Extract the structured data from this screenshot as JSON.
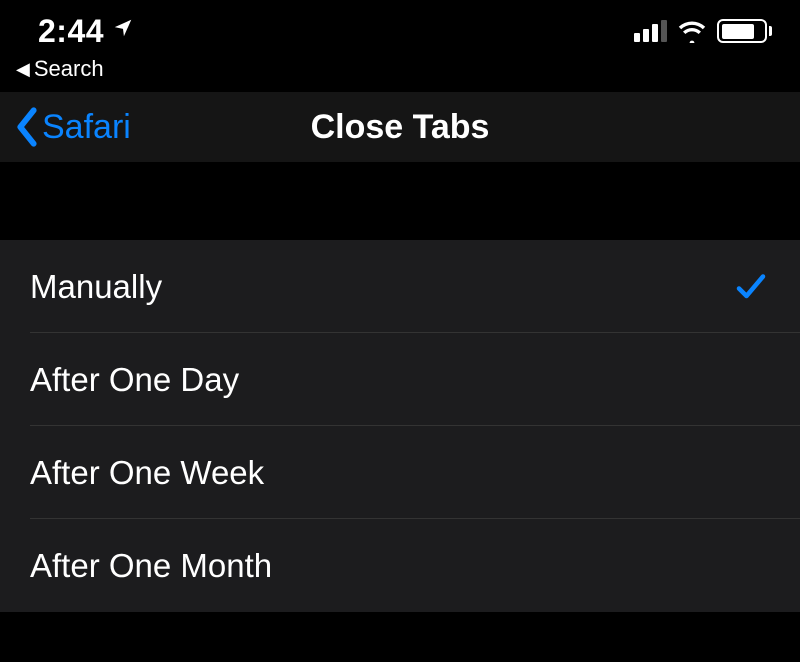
{
  "status": {
    "time": "2:44",
    "breadcrumb": "Search"
  },
  "nav": {
    "back_label": "Safari",
    "title": "Close Tabs"
  },
  "options": [
    {
      "label": "Manually",
      "selected": true
    },
    {
      "label": "After One Day",
      "selected": false
    },
    {
      "label": "After One Week",
      "selected": false
    },
    {
      "label": "After One Month",
      "selected": false
    }
  ],
  "colors": {
    "accent": "#0a84ff"
  }
}
